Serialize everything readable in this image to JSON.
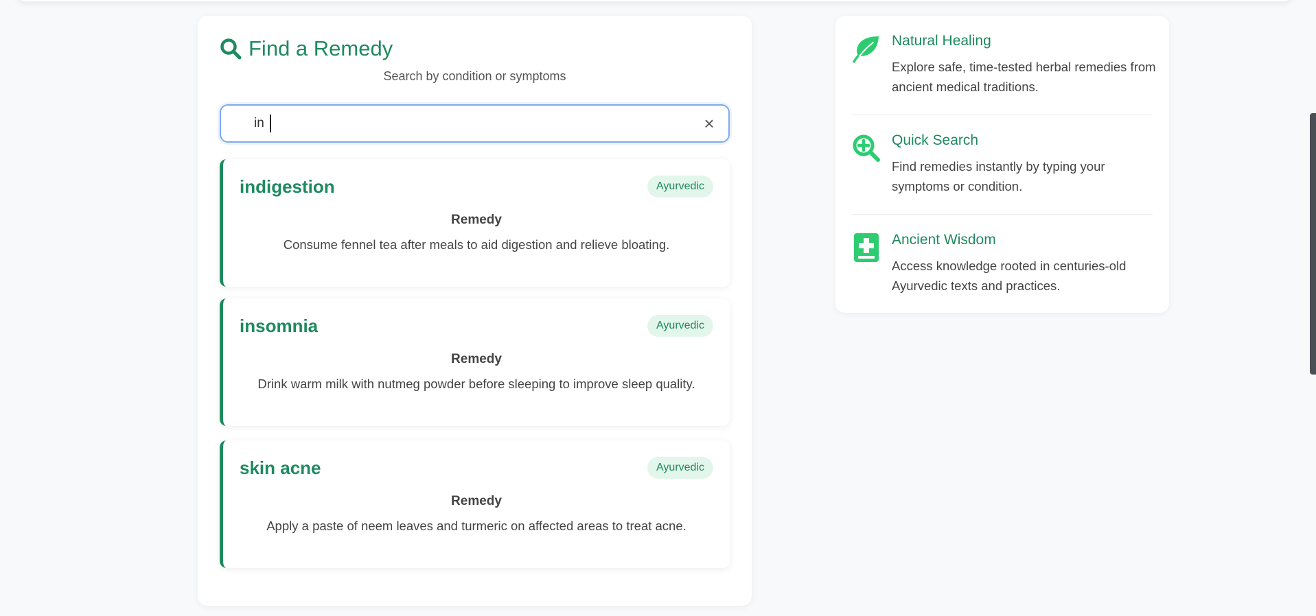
{
  "colors": {
    "accent": "#1e8a5f",
    "icon_green": "#2ecc71",
    "badge_bg": "#e3f6ec",
    "focus_border": "#7eaaf0"
  },
  "search": {
    "icon": "search-icon",
    "title": "Find a Remedy",
    "subtitle": "Search by condition or symptoms",
    "query": "in",
    "clear_icon": "close-icon",
    "clear_symbol": "×"
  },
  "results": [
    {
      "title": "indigestion",
      "badge": "Ayurvedic",
      "label": "Remedy",
      "text": "Consume fennel tea after meals to aid digestion and relieve bloating."
    },
    {
      "title": "insomnia",
      "badge": "Ayurvedic",
      "label": "Remedy",
      "text": "Drink warm milk with nutmeg powder before sleeping to improve sleep quality."
    },
    {
      "title": "skin acne",
      "badge": "Ayurvedic",
      "label": "Remedy",
      "text": "Apply a paste of neem leaves and turmeric on affected areas to treat acne."
    }
  ],
  "features": [
    {
      "icon": "leaf-icon",
      "title": "Natural Healing",
      "text": "Explore safe, time-tested herbal remedies from ancient medical traditions."
    },
    {
      "icon": "search-plus-icon",
      "title": "Quick Search",
      "text": "Find remedies instantly by typing your symptoms or condition."
    },
    {
      "icon": "medical-book-icon",
      "title": "Ancient Wisdom",
      "text": "Access knowledge rooted in centuries-old Ayurvedic texts and practices."
    }
  ]
}
